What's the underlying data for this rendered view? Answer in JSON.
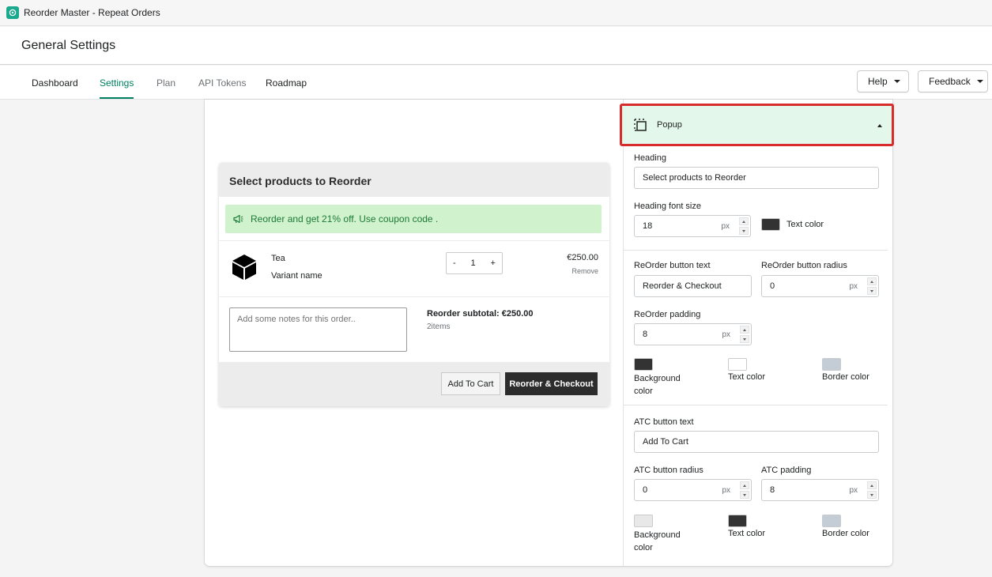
{
  "app": {
    "name": "Reorder Master - Repeat Orders",
    "icon": "app-logo-icon",
    "brand_color": "#1aa88f"
  },
  "page": {
    "title": "General Settings"
  },
  "tabs": [
    {
      "label": "Dashboard"
    },
    {
      "label": "Settings",
      "active": true
    },
    {
      "label": "Plan"
    },
    {
      "label": "API Tokens"
    },
    {
      "label": "Roadmap"
    }
  ],
  "header_buttons": {
    "help": "Help",
    "feedback": "Feedback"
  },
  "preview": {
    "heading": "Select products to Reorder",
    "banner": "Reorder and get 21% off. Use coupon code .",
    "product": {
      "name": "Tea",
      "variant": "Variant name",
      "quantity": "1",
      "price": "€250.00",
      "remove": "Remove",
      "minus": "-",
      "plus": "+"
    },
    "notes_placeholder": "Add some notes for this order..",
    "subtotal": "Reorder subtotal: €250.00",
    "items": "2items",
    "atc_button": "Add To Cart",
    "checkout_button": "Reorder & Checkout"
  },
  "panel": {
    "section_title": "Popup",
    "heading_label": "Heading",
    "heading_value": "Select products to Reorder",
    "heading_font_size_label": "Heading font size",
    "heading_font_size": "18",
    "px": "px",
    "text_color_label": "Text color",
    "text_color": "#333333",
    "reorder_button_text_label": "ReOrder button text",
    "reorder_button_text": "Reorder & Checkout",
    "reorder_button_radius_label": "ReOrder button radius",
    "reorder_button_radius": "0",
    "reorder_padding_label": "ReOrder padding",
    "reorder_padding": "8",
    "reorder_colors": {
      "background_label": "Background color",
      "background": "#333333",
      "text_label": "Text color",
      "text": "#ffffff",
      "border_label": "Border color",
      "border": "#c4cdd5"
    },
    "atc_button_text_label": "ATC button text",
    "atc_button_text": "Add To Cart",
    "atc_button_radius_label": "ATC button radius",
    "atc_button_radius": "0",
    "atc_padding_label": "ATC padding",
    "atc_padding": "8",
    "atc_colors": {
      "background_label": "Background color",
      "background": "#e8e8e8",
      "text_label": "Text color",
      "text": "#333333",
      "border_label": "Border color",
      "border": "#c4cdd5"
    }
  }
}
